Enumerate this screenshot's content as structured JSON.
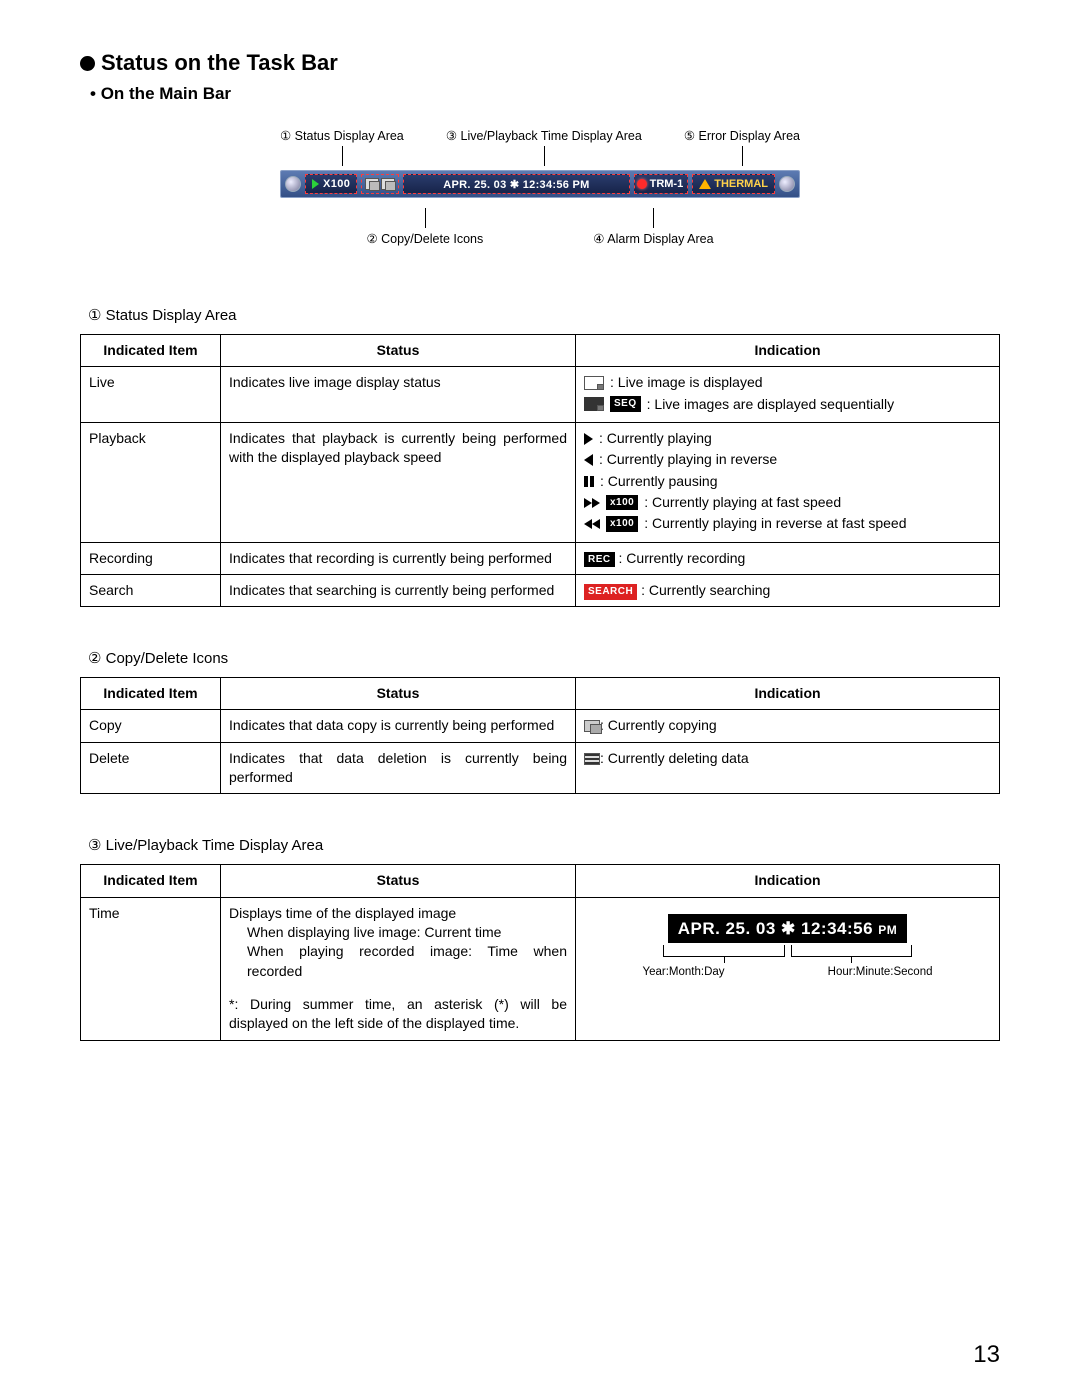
{
  "heading": "Status on the Task Bar",
  "subheading": "On the Main Bar",
  "pageNumber": "13",
  "callouts": {
    "top1": "① Status Display Area",
    "top2": "③ Live/Playback Time Display Area",
    "top3": "⑤ Error Display Area",
    "bottom1": "② Copy/Delete Icons",
    "bottom2": "④ Alarm Display Area"
  },
  "taskbar": {
    "statusSpeed": "X100",
    "time": "APR. 25. 03 ✱ 12:34:56 PM",
    "alarm": "TRM-1",
    "error": "THERMAL"
  },
  "tableHeaders": {
    "item": "Indicated Item",
    "status": "Status",
    "indication": "Indication"
  },
  "section1": {
    "title": "①  Status Display Area",
    "rows": {
      "live": {
        "item": "Live",
        "status": "Indicates live image display status",
        "ind1": ": Live image is displayed",
        "ind2": ": Live images are displayed sequentially",
        "seqTag": "SEQ"
      },
      "playback": {
        "item": "Playback",
        "status": "Indicates that playback is currently being performed with the displayed playback speed",
        "l1": ": Currently playing",
        "l2": ": Currently playing in reverse",
        "l3": ": Currently pausing",
        "l4": ": Currently playing at fast speed",
        "l5": ": Currently playing in reverse at fast speed",
        "x100": "x100"
      },
      "recording": {
        "item": "Recording",
        "status": "Indicates that recording is currently being performed",
        "tag": "REC",
        "txt": ": Currently recording"
      },
      "search": {
        "item": "Search",
        "status": "Indicates that searching is currently being performed",
        "tag": "SEARCH",
        "txt": ": Currently searching"
      }
    }
  },
  "section2": {
    "title": "②  Copy/Delete Icons",
    "rows": {
      "copy": {
        "item": "Copy",
        "status": "Indicates that data copy is currently being performed",
        "txt": ": Currently copying"
      },
      "delete": {
        "item": "Delete",
        "status": "Indicates that data deletion is currently being performed",
        "txt": ": Currently deleting data"
      }
    }
  },
  "section3": {
    "title": "③  Live/Playback Time Display Area",
    "time": {
      "item": "Time",
      "statusMain": "Displays time of the displayed image",
      "statusSub1": "When displaying live image: Current time",
      "statusSub2": "When playing recorded image: Time when recorded",
      "statusNote": "*: During summer time, an asterisk (*) will be displayed on the left side of the displayed time.",
      "timeStr": "APR. 25. 03 ✱ 12:34:56",
      "timeSuffix": "PM",
      "labelLeft": "Year:Month:Day",
      "labelRight": "Hour:Minute:Second"
    }
  }
}
